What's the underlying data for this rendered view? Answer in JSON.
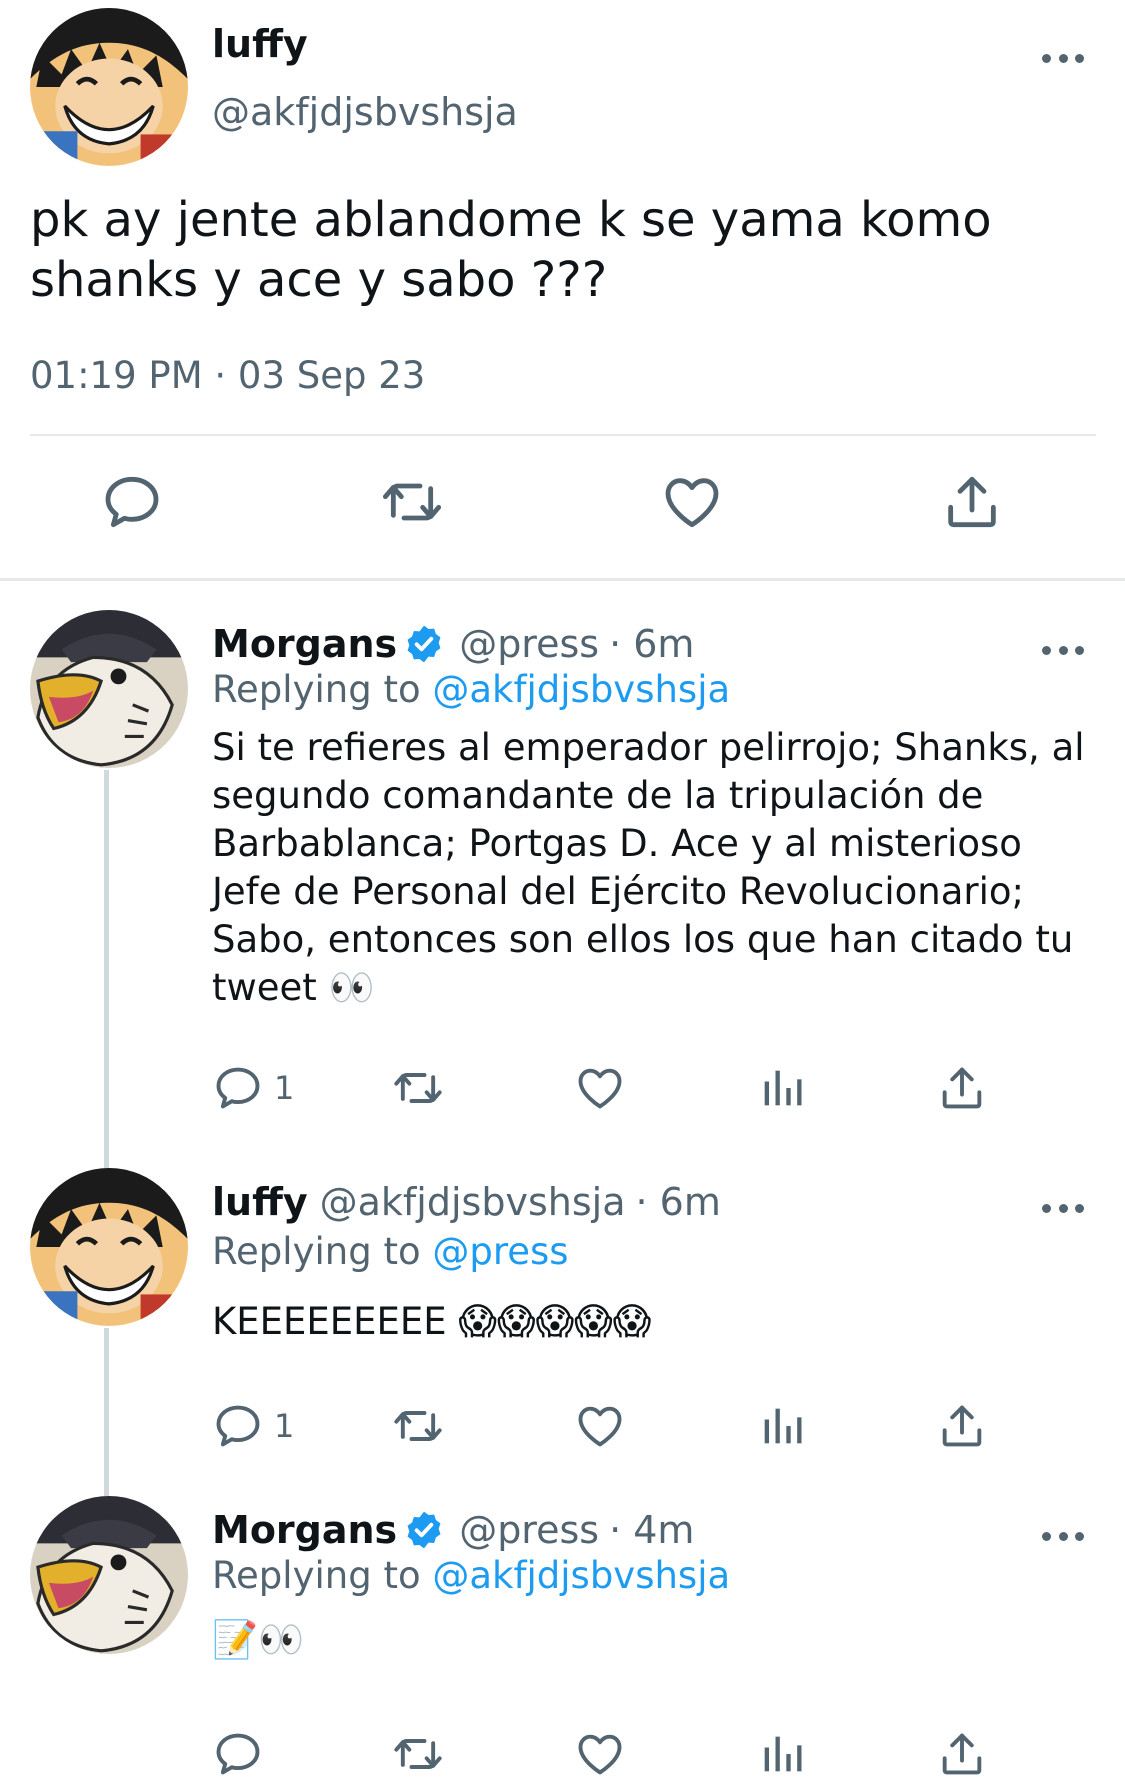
{
  "main_tweet": {
    "author_name": "luffy",
    "author_handle": "@akfjdjsbvshsja",
    "text": "pk ay jente ablandome k se yama komo shanks y ace y sabo ???",
    "timestamp": "01:19 PM · 03 Sep 23",
    "actions": [
      "reply-icon",
      "retweet-icon",
      "like-icon",
      "share-icon"
    ]
  },
  "replies": [
    {
      "author_name": "Morgans",
      "verified": true,
      "author_handle": "@press",
      "time": "· 6m",
      "replying_prefix": "Replying to",
      "replying_to": "@akfjdjsbvshsja",
      "text": "Si te refieres al emperador pelirrojo; Shanks, al segundo comandante de la tripulación de Barbablanca; Portgas D. Ace y al misterioso Jefe de Personal del Ejército Revolucionario; Sabo, entonces son ellos los que han citado tu tweet 👀",
      "reply_count": "1"
    },
    {
      "author_name": "luffy",
      "verified": false,
      "author_handle": "@akfjdjsbvshsja",
      "time": "· 6m",
      "replying_prefix": "Replying to",
      "replying_to": "@press",
      "text": "KEEEEEEEEE 😱😱😱😱😱",
      "reply_count": "1"
    },
    {
      "author_name": "Morgans",
      "verified": true,
      "author_handle": "@press",
      "time": "· 4m",
      "replying_prefix": "Replying to",
      "replying_to": "@akfjdjsbvshsja",
      "text": "📝👀",
      "reply_count": ""
    }
  ],
  "colors": {
    "link": "#1d9bf0",
    "muted": "#536471",
    "thread_line": "#cfd9de"
  }
}
